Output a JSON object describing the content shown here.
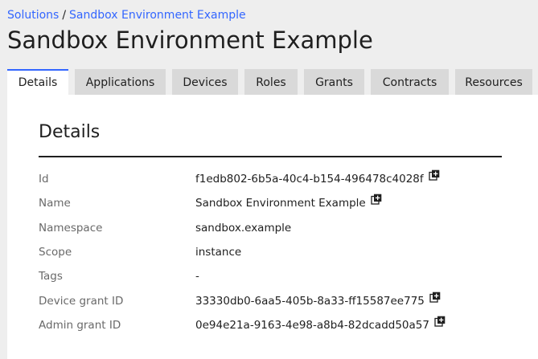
{
  "breadcrumb": {
    "root": "Solutions",
    "separator": "/",
    "current": "Sandbox Environment Example"
  },
  "page": {
    "title": "Sandbox Environment Example"
  },
  "tabs": [
    {
      "label": "Details",
      "active": true
    },
    {
      "label": "Applications",
      "active": false
    },
    {
      "label": "Devices",
      "active": false
    },
    {
      "label": "Roles",
      "active": false
    },
    {
      "label": "Grants",
      "active": false
    },
    {
      "label": "Contracts",
      "active": false
    },
    {
      "label": "Resources",
      "active": false
    }
  ],
  "details": {
    "title": "Details",
    "rows": [
      {
        "label": "Id",
        "value": "f1edb802-6b5a-40c4-b154-496478c4028f",
        "copy_icon": "copy-icon"
      },
      {
        "label": "Name",
        "value": "Sandbox Environment Example",
        "copy_icon": "copy-icon"
      },
      {
        "label": "Namespace",
        "value": "sandbox.example"
      },
      {
        "label": "Scope",
        "value": "instance"
      },
      {
        "label": "Tags",
        "value": "-"
      },
      {
        "label": "Device grant ID",
        "value": "33330db0-6aa5-405b-8a33-ff15587ee775",
        "copy_icon": "copy-icon"
      },
      {
        "label": "Admin grant ID",
        "value": "0e94e21a-9163-4e98-a8b4-82dcadd50a57",
        "copy_icon": "copy-icon"
      }
    ]
  },
  "colors": {
    "accent": "#3366ff",
    "background": "#eeeeee",
    "tab_inactive": "#d9d9d9",
    "panel": "#ffffff"
  }
}
